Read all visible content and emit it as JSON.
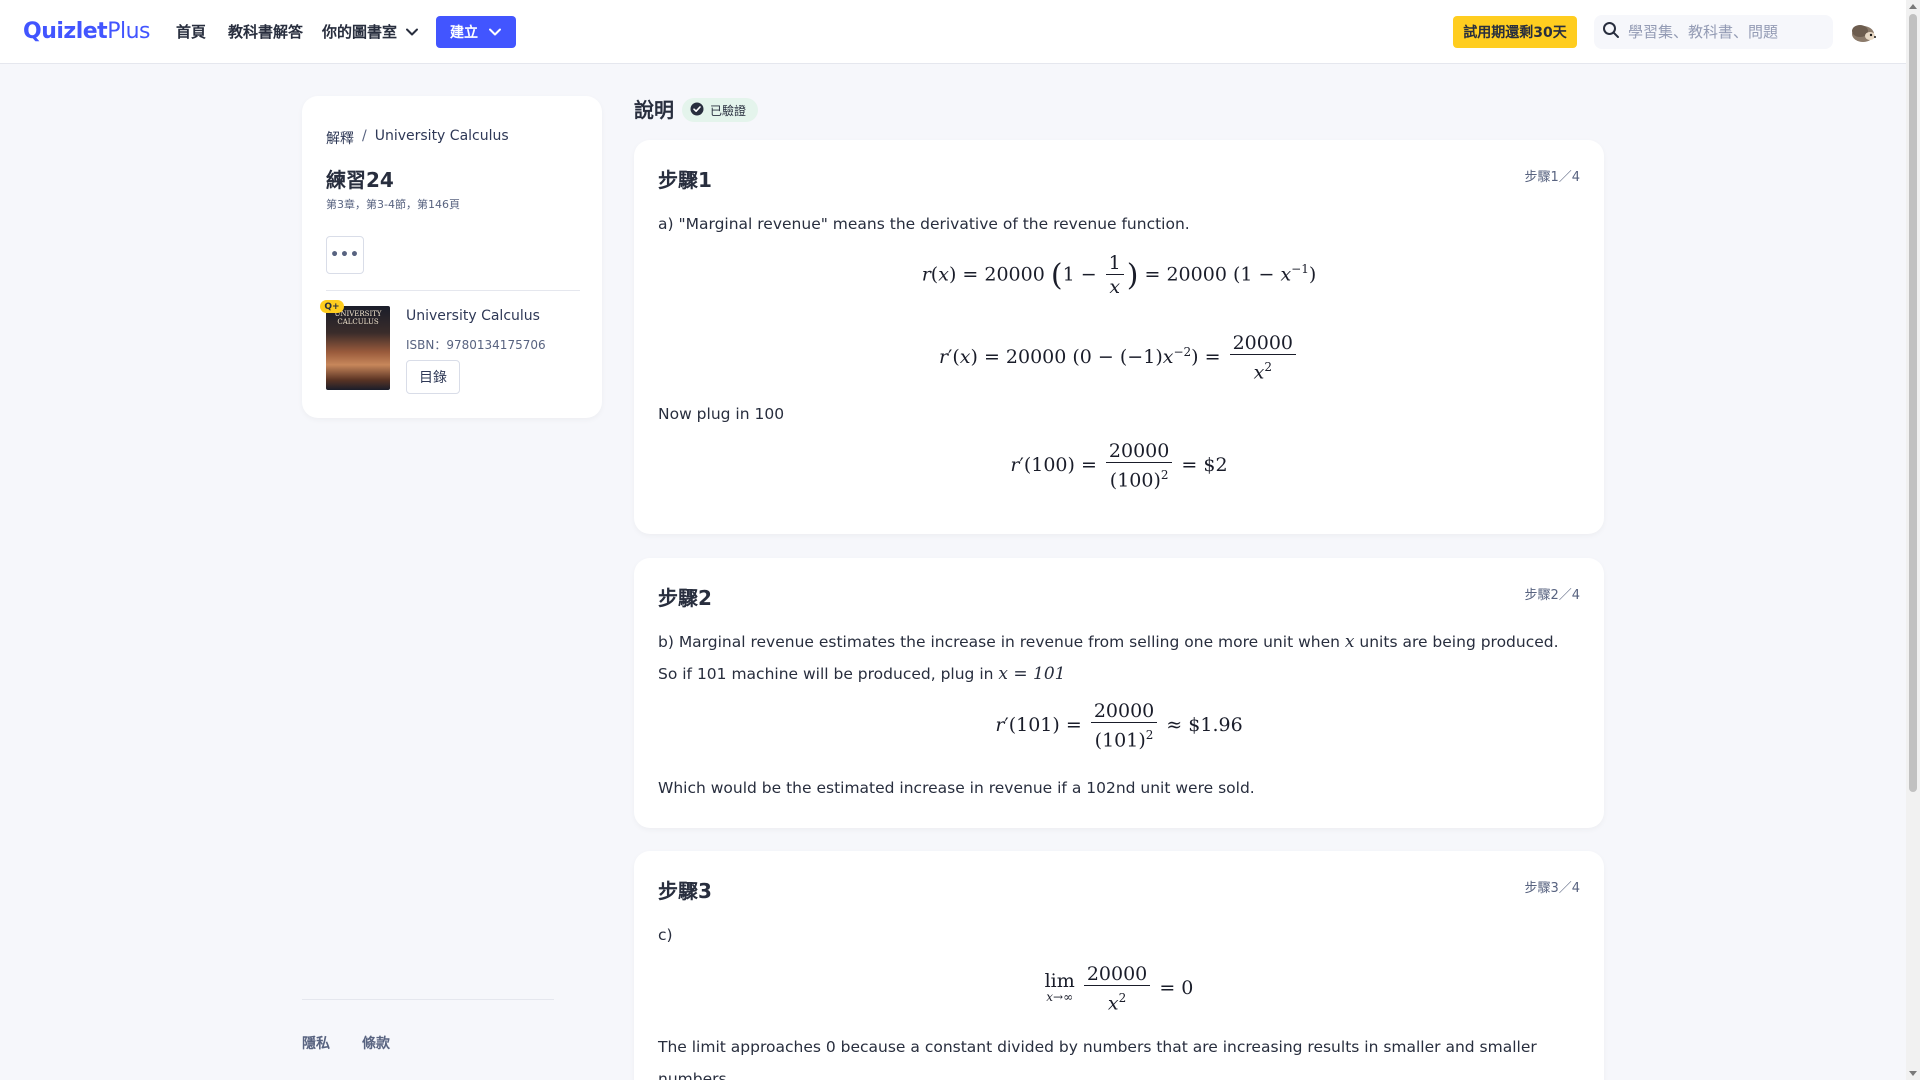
{
  "nav": {
    "logo_primary": "Quizlet",
    "logo_secondary": "Plus",
    "home": "首頁",
    "solutions": "教科書解答",
    "library": "你的圖書室",
    "create": "建立",
    "trial": "試用期還剩30天",
    "search_placeholder": "學習集、教科書、問題"
  },
  "sidebar": {
    "breadcrumb_root": "解釋",
    "breadcrumb_sep": "/",
    "breadcrumb_book": "University Calculus",
    "exercise_title": "練習24",
    "exercise_meta": "第3章，第3-4節，第146頁",
    "more": "•••",
    "badge": "Q+",
    "cover_text": "UNIVERSITY CALCULUS",
    "book_title": "University Calculus",
    "isbn": "ISBN：9780134175706",
    "toc": "目錄"
  },
  "footer": {
    "privacy": "隱私",
    "terms": "條款"
  },
  "main": {
    "title": "說明",
    "verified": "已驗證",
    "steps": [
      {
        "title": "步驟1",
        "count": "步驟1／4",
        "intro": "a) \"Marginal revenue\" means the derivative of the revenue function.",
        "plug": "Now plug in 100"
      },
      {
        "title": "步驟2",
        "count": "步驟2／4",
        "intro_a": "b) Marginal revenue estimates the increase in revenue from selling one more unit when",
        "intro_var": "x",
        "intro_b": "units are being produced. So if 101 machine will be produced, plug in",
        "intro_eq": "x = 101",
        "conclusion": "Which would be the estimated increase in revenue if a 102nd unit were sold."
      },
      {
        "title": "步驟3",
        "count": "步驟3／4",
        "intro": "c)",
        "conclusion": "The limit approaches 0 because a constant divided by numbers that are increasing results in smaller and smaller numbers."
      }
    ]
  }
}
